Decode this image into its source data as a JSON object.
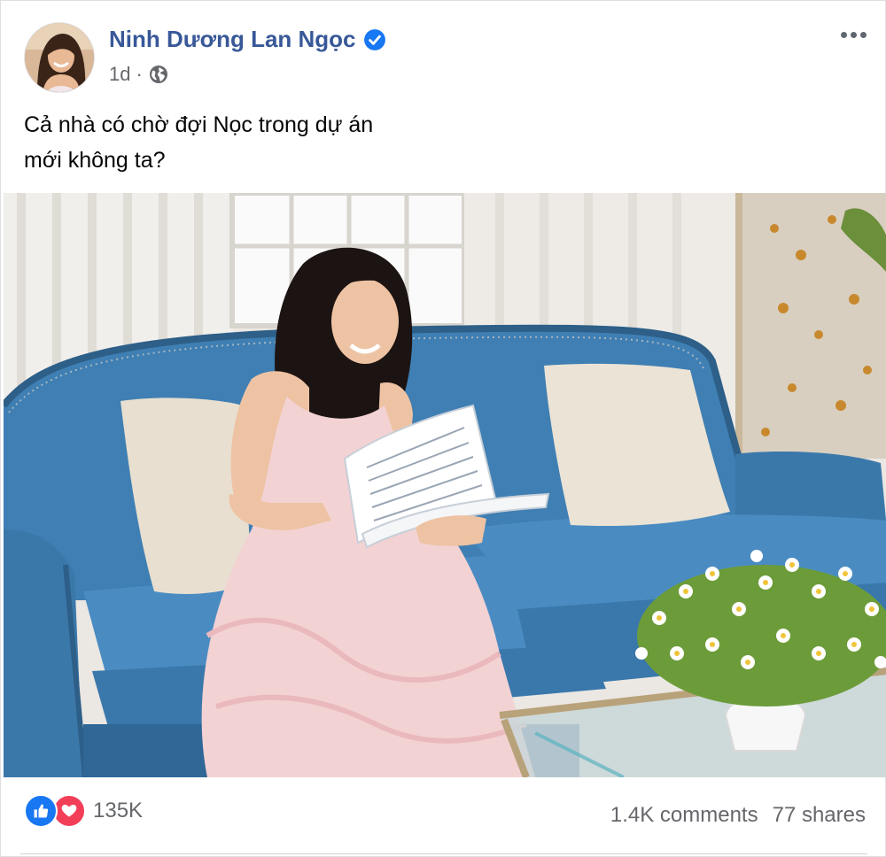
{
  "post": {
    "author": {
      "name": "Ninh Dương Lan Ngọc",
      "verified": true,
      "verified_icon": "verified-badge-icon"
    },
    "timestamp": "1d",
    "separator": "·",
    "privacy_icon": "globe-icon",
    "caption_lines": [
      "Cả nhà có chờ đợi Nọc trong dự án",
      "mới không ta?"
    ],
    "image_icon": "photo-woman-reading-script-on-blue-sofa"
  },
  "reactions": {
    "icons": [
      "like-icon",
      "love-icon"
    ],
    "count": "135K"
  },
  "stats": {
    "comments": "1.4K comments",
    "shares": "77 shares"
  },
  "colors": {
    "author_name": "#385898",
    "verified": "#1877f2",
    "like": "#1877f2",
    "love": "#f33e58",
    "meta": "#65676b"
  }
}
